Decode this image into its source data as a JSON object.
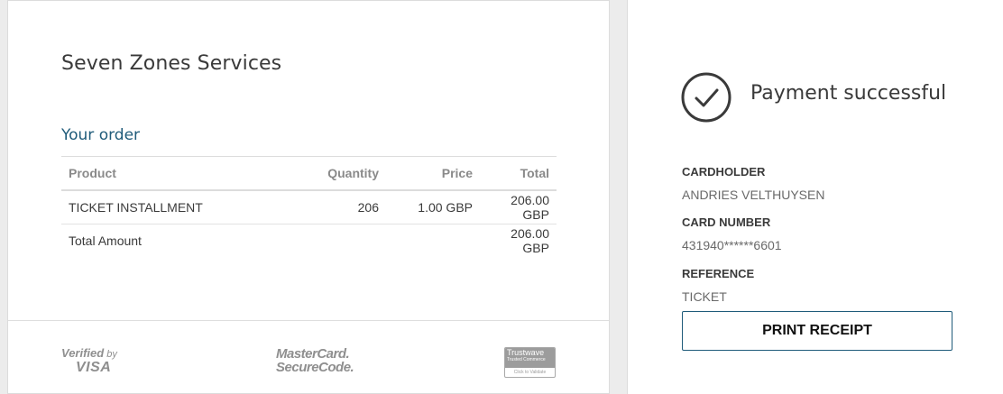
{
  "merchant": {
    "name": "Seven Zones Services"
  },
  "order": {
    "title": "Your order",
    "columns": {
      "product": "Product",
      "quantity": "Quantity",
      "price": "Price",
      "total": "Total"
    },
    "items": [
      {
        "product": "TICKET INSTALLMENT",
        "quantity": "206",
        "price": "1.00 GBP",
        "total": "206.00 GBP"
      }
    ],
    "total_row": {
      "label": "Total Amount",
      "value": "206.00 GBP"
    }
  },
  "badges": {
    "visa": {
      "line1": "Verified",
      "line1_by": "by",
      "line2": "VISA"
    },
    "mastercard": {
      "line1": "MasterCard.",
      "line2": "SecureCode."
    },
    "trustwave": {
      "brand": "Trustwave",
      "sub": "Trusted Commerce",
      "cta": "Click to Validate"
    }
  },
  "payment": {
    "status": "Payment successful",
    "status_icon": "checkmark-circle-icon",
    "cardholder_label": "CARDHOLDER",
    "cardholder_value": "ANDRIES VELTHUYSEN",
    "card_number_label": "CARD NUMBER",
    "card_number_value": "431940******6601",
    "reference_label": "REFERENCE",
    "reference_value": "TICKET",
    "print_label": "PRINT RECEIPT"
  },
  "colors": {
    "accent": "#1f5b7a",
    "text": "#3a3a3a",
    "muted": "#8a8a8a",
    "background": "#ececec"
  }
}
